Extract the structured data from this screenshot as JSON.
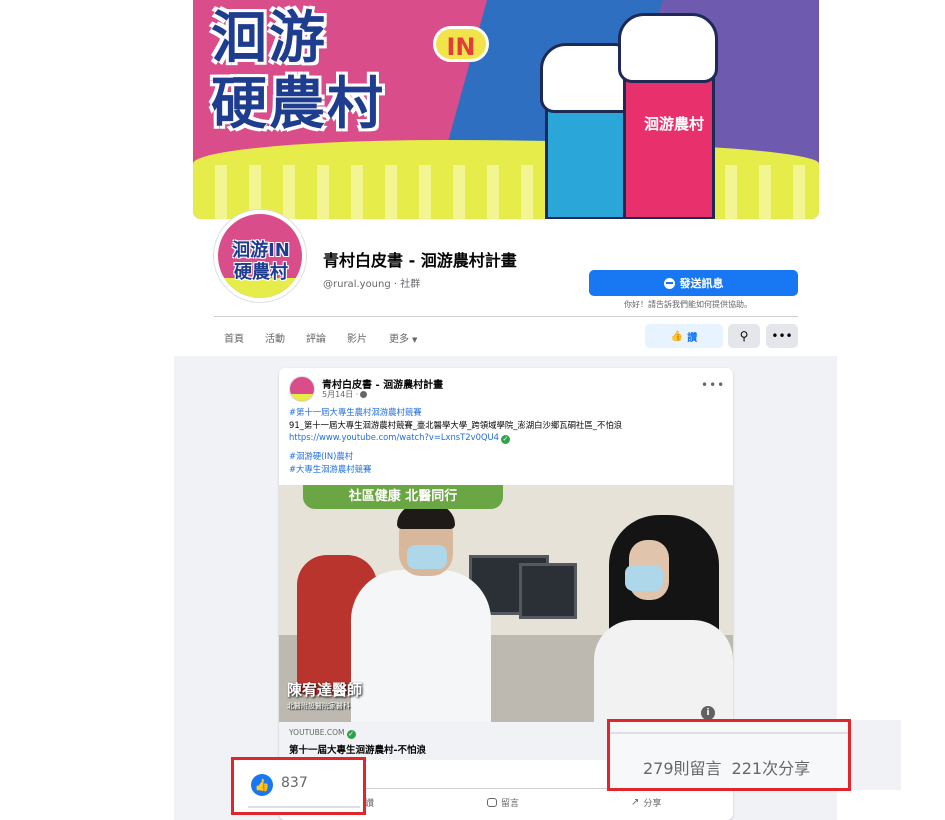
{
  "cover": {
    "title_line1": "洄游",
    "title_in": "IN",
    "title_line2": "硬農村",
    "fist_label": "洄游農村"
  },
  "avatar": {
    "line1": "洄游IN",
    "line2": "硬農村"
  },
  "page": {
    "name": "青村白皮書 - 洄游農村計畫",
    "handle": "@rural.young · 社群",
    "send_message_label": "發送訊息",
    "respond_note": "你好！請告訴我們能如何提供協助。"
  },
  "nav": {
    "items": [
      "首頁",
      "活動",
      "評論",
      "影片",
      "更多"
    ],
    "like_label": "讚",
    "search_icon": "search-icon",
    "more_icon": "more-icon"
  },
  "post": {
    "author": "青村白皮書 - 洄游農村計畫",
    "date": "5月14日 ·",
    "lines": [
      "#第十一屆大專生農村洄游農村競賽",
      "91_第十一屆大專生洄游農村競賽_臺北醫學大學_跨領域學院_澎湖白沙鄉瓦硐社區_不怕浪",
      "https://www.youtube.com/watch?v=LxnsT2v0QU4",
      "#洄游硬(IN)農村",
      "#大專生洄游農村競賽"
    ],
    "video": {
      "sign": "社區健康 北醫同行",
      "caption": "陳宥達醫師",
      "subcaption": "北醫附設醫院家醫科"
    },
    "link_domain": "YOUTUBE.COM",
    "link_title": "第十一屆大專生洄游農村-不怕浪",
    "actions": {
      "like": "讚",
      "comment": "留言",
      "share": "分享"
    }
  },
  "highlight": {
    "likes": "837",
    "comments": "279則留言",
    "shares": "221次分享"
  },
  "colors": {
    "brand_blue": "#1877f2",
    "highlight_red": "#e0262c",
    "hashtag": "#216fdb"
  }
}
